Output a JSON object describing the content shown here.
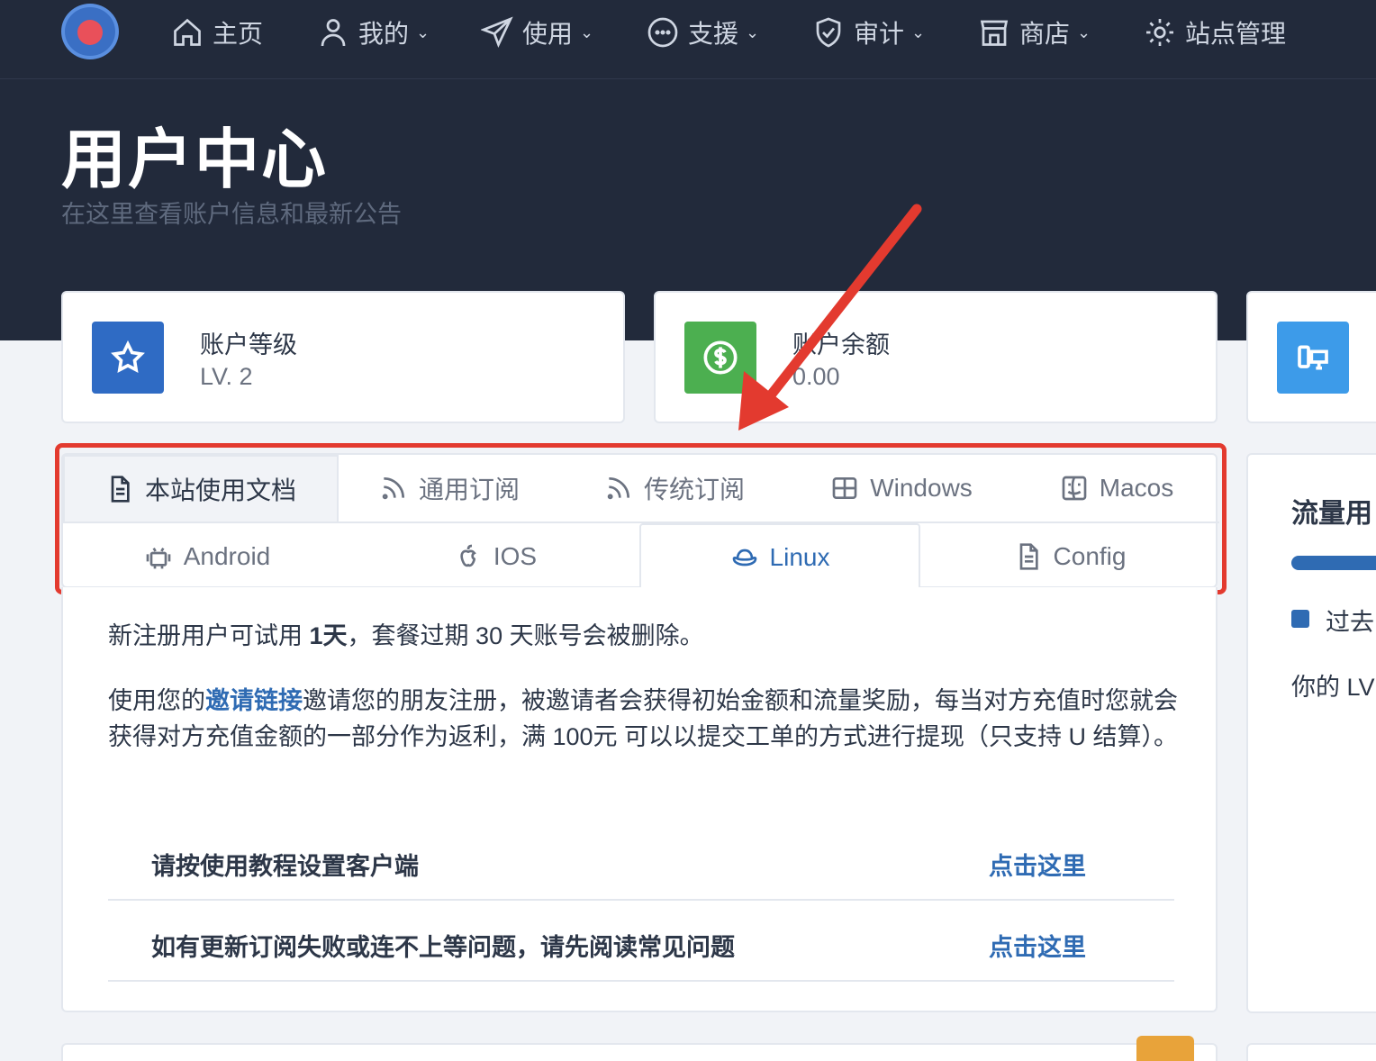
{
  "nav": {
    "items": [
      {
        "label": "主页",
        "icon": "home-icon",
        "has_menu": false
      },
      {
        "label": "我的",
        "icon": "user-icon",
        "has_menu": true
      },
      {
        "label": "使用",
        "icon": "paper-plane-icon",
        "has_menu": true
      },
      {
        "label": "支援",
        "icon": "chat-dots-icon",
        "has_menu": true
      },
      {
        "label": "审计",
        "icon": "shield-check-icon",
        "has_menu": true
      },
      {
        "label": "商店",
        "icon": "store-icon",
        "has_menu": true
      },
      {
        "label": "站点管理",
        "icon": "gear-icon",
        "has_menu": false
      }
    ],
    "chevron": "⌄"
  },
  "header": {
    "title": "用户中心",
    "subtitle": "在这里查看账户信息和最新公告"
  },
  "stats": [
    {
      "label": "账户等级",
      "value": "LV. 2",
      "icon": "star-icon",
      "color": "#2f6bc4"
    },
    {
      "label": "账户余额",
      "value": "0.00",
      "icon": "dollar-icon",
      "color": "#4caf50"
    },
    {
      "label": "",
      "value": "",
      "icon": "devices-icon",
      "color": "#3d9be9"
    }
  ],
  "tabs": {
    "row1": [
      {
        "label": "本站使用文档",
        "icon": "document-icon"
      },
      {
        "label": "通用订阅",
        "icon": "rss-icon"
      },
      {
        "label": "传统订阅",
        "icon": "rss-icon"
      },
      {
        "label": "Windows",
        "icon": "windows-icon"
      },
      {
        "label": "Macos",
        "icon": "finder-icon"
      }
    ],
    "row2": [
      {
        "label": "Android",
        "icon": "android-icon"
      },
      {
        "label": "IOS",
        "icon": "apple-icon"
      },
      {
        "label": "Linux",
        "icon": "redhat-icon"
      },
      {
        "label": "Config",
        "icon": "document-icon"
      }
    ],
    "selected": "Linux"
  },
  "content": {
    "p1_a": "新注册用户可试用 ",
    "p1_b": "1天",
    "p1_c": "，套餐过期 30 天账号会被删除。",
    "p2_a": "使用您的",
    "p2_link": "邀请链接",
    "p2_b": "邀请您的朋友注册，被邀请者会获得初始金额和流量奖励，每当对方充值时您就会获得对方充值金额的一部分作为返利，满 100元 可以以提交工单的方式进行提现（只支持 U 结算）。",
    "rows": [
      {
        "label": "请按使用教程设置客户端",
        "link": "点击这里"
      },
      {
        "label": "如有更新订阅失败或连不上等问题，请先阅读常见问题",
        "link": "点击这里"
      }
    ]
  },
  "right_panel": {
    "title": "流量用",
    "legend": "过去",
    "note": "你的 LV"
  },
  "colors": {
    "hero_bg": "#222a3b",
    "accent": "#2f6bb3",
    "highlight": "#e33a2f"
  }
}
